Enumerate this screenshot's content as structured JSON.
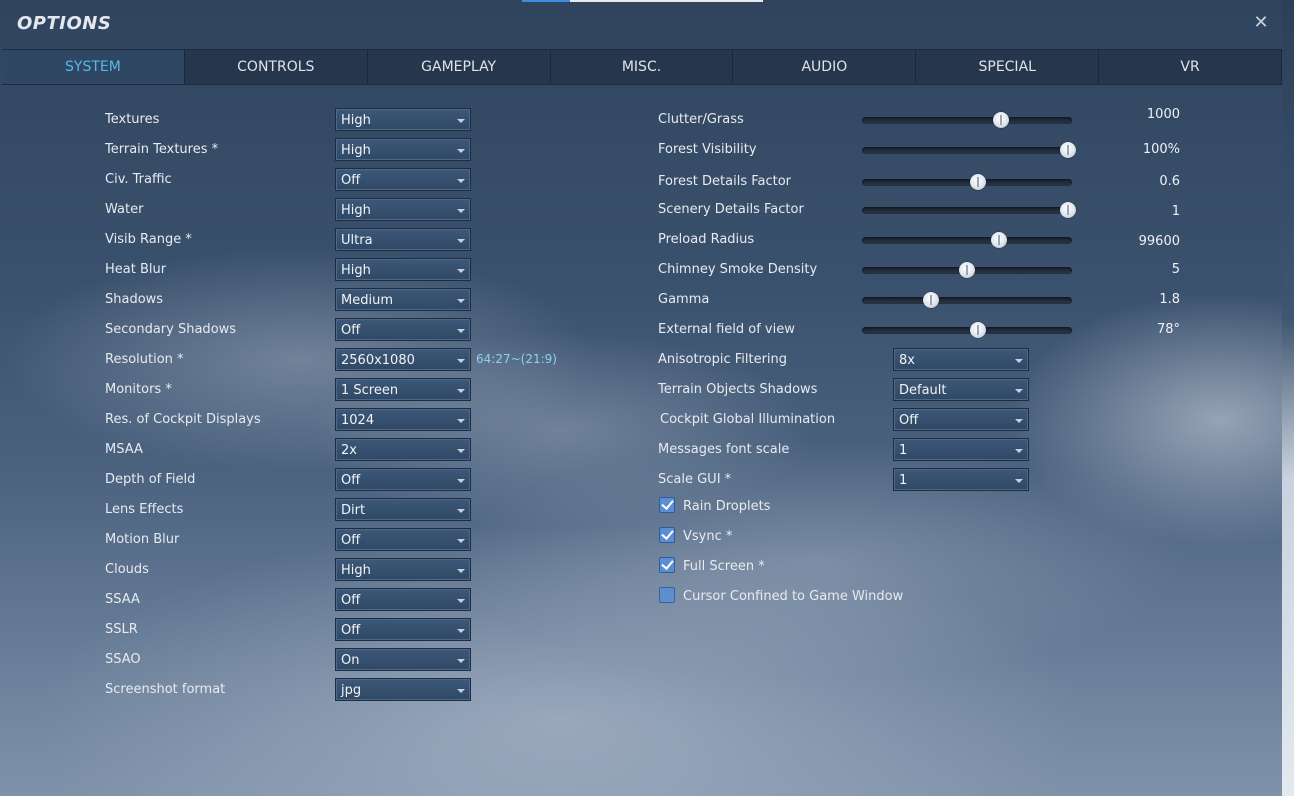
{
  "header": {
    "title": "OPTIONS",
    "close_icon": "close-icon"
  },
  "tabs": [
    {
      "label": "SYSTEM",
      "active": true
    },
    {
      "label": "CONTROLS"
    },
    {
      "label": "GAMEPLAY"
    },
    {
      "label": "MISC."
    },
    {
      "label": "AUDIO"
    },
    {
      "label": "SPECIAL"
    },
    {
      "label": "VR"
    }
  ],
  "left_settings": [
    {
      "label": "Textures",
      "value": "High"
    },
    {
      "label": "Terrain Textures *",
      "value": "High"
    },
    {
      "label": "Civ. Traffic",
      "value": "Off"
    },
    {
      "label": "Water",
      "value": "High"
    },
    {
      "label": "Visib Range *",
      "value": "Ultra"
    },
    {
      "label": "Heat Blur",
      "value": "High"
    },
    {
      "label": "Shadows",
      "value": "Medium"
    },
    {
      "label": "Secondary Shadows",
      "value": "Off"
    },
    {
      "label": "Resolution *",
      "value": "2560x1080",
      "note": "64:27~(21:9)"
    },
    {
      "label": "Monitors *",
      "value": "1 Screen"
    },
    {
      "label": "Res. of Cockpit Displays",
      "value": "1024"
    },
    {
      "label": "MSAA",
      "value": "2x"
    },
    {
      "label": "Depth of Field",
      "value": "Off"
    },
    {
      "label": "Lens Effects",
      "value": "Dirt"
    },
    {
      "label": "Motion Blur",
      "value": "Off"
    },
    {
      "label": "Clouds",
      "value": "High"
    },
    {
      "label": "SSAA",
      "value": "Off"
    },
    {
      "label": "SSLR",
      "value": "Off"
    },
    {
      "label": "SSAO",
      "value": "On"
    },
    {
      "label": "Screenshot format",
      "value": "jpg"
    }
  ],
  "sliders": [
    {
      "label": "Clutter/Grass",
      "value": "1000",
      "fraction": 0.66
    },
    {
      "label": "Forest Visibility",
      "value": "100%",
      "fraction": 0.98
    },
    {
      "label": "Forest Details Factor",
      "value": "0.6",
      "fraction": 0.55
    },
    {
      "label": "Scenery Details Factor",
      "value": "1",
      "fraction": 0.98
    },
    {
      "label": "Preload Radius",
      "value": "99600",
      "fraction": 0.65
    },
    {
      "label": "Chimney Smoke Density",
      "value": "5",
      "fraction": 0.5
    },
    {
      "label": "Gamma",
      "value": "1.8",
      "fraction": 0.33
    },
    {
      "label": "External field of view",
      "value": "78°",
      "fraction": 0.55
    }
  ],
  "right_dropdowns": [
    {
      "label": "Anisotropic Filtering",
      "value": "8x"
    },
    {
      "label": "Terrain Objects Shadows",
      "value": "Default"
    },
    {
      "label": "Cockpit Global Illumination",
      "value": "Off"
    },
    {
      "label": "Messages font scale",
      "value": "1"
    },
    {
      "label": "Scale GUI *",
      "value": "1"
    }
  ],
  "checkboxes": [
    {
      "label": "Rain Droplets",
      "checked": true
    },
    {
      "label": "Vsync *",
      "checked": true
    },
    {
      "label": "Full Screen *",
      "checked": true
    },
    {
      "label": "Cursor Confined to Game Window",
      "checked": false
    }
  ]
}
